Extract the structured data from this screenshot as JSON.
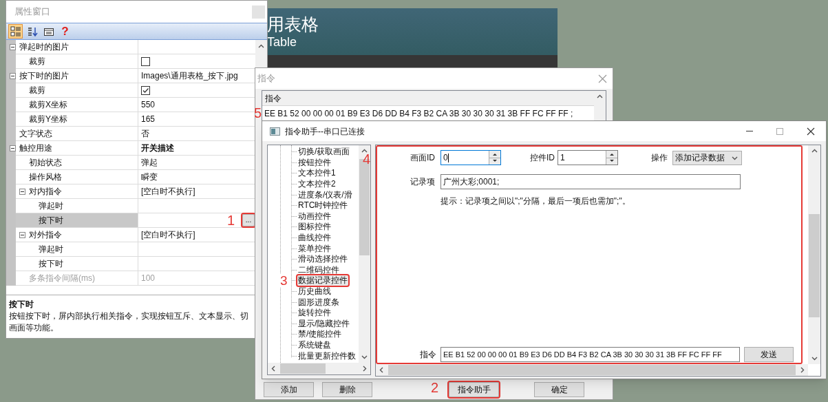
{
  "preview_screen": {
    "title": "用表格",
    "subtitle": "Table"
  },
  "property_window": {
    "title": "属性窗口",
    "toolbar": [
      {
        "kind": "categorized",
        "selected": true
      },
      {
        "kind": "alphabetical",
        "selected": false
      },
      {
        "kind": "property-pages",
        "selected": false
      },
      {
        "kind": "help",
        "selected": false,
        "label": "?"
      }
    ],
    "rows": [
      {
        "name": "弹起时的图片",
        "kind": "group",
        "expanded": true,
        "selected": false,
        "disabled": false,
        "children": [
          {
            "name": "裁剪",
            "kind": "checkbox",
            "checked": false,
            "selected": false,
            "disabled": false
          }
        ]
      },
      {
        "name": "按下时的图片",
        "kind": "group",
        "expanded": true,
        "value": "Images\\通用表格_按下.jpg",
        "selected": false,
        "disabled": false,
        "children": [
          {
            "name": "裁剪",
            "kind": "checkbox",
            "checked": true,
            "selected": false,
            "disabled": false
          },
          {
            "name": "裁剪X坐标",
            "kind": "text",
            "value": "550",
            "selected": false,
            "disabled": false
          },
          {
            "name": "裁剪Y坐标",
            "kind": "text",
            "value": "165",
            "selected": false,
            "disabled": false
          }
        ]
      },
      {
        "name": "文字状态",
        "kind": "text",
        "value": "否",
        "selected": false,
        "disabled": false
      },
      {
        "name": "触控用途",
        "kind": "group",
        "expanded": true,
        "value": "开关描述",
        "value_bold": true,
        "selected": false,
        "disabled": false,
        "children": [
          {
            "name": "初始状态",
            "kind": "text",
            "value": "弹起",
            "selected": false,
            "disabled": false
          },
          {
            "name": "操作风格",
            "kind": "text",
            "value": "瞬变",
            "selected": false,
            "disabled": false
          },
          {
            "name": "对内指令",
            "kind": "group",
            "expanded": true,
            "value": "[空白时不执行]",
            "selected": false,
            "disabled": false,
            "children": [
              {
                "name": "弹起时",
                "kind": "text",
                "selected": false,
                "disabled": false
              },
              {
                "name": "按下时",
                "kind": "text",
                "selected": true,
                "disabled": false,
                "button": "...",
                "annotation": "1"
              }
            ]
          },
          {
            "name": "对外指令",
            "kind": "group",
            "expanded": true,
            "value": "[空白时不执行]",
            "selected": false,
            "disabled": false,
            "children": [
              {
                "name": "弹起时",
                "kind": "text",
                "selected": false,
                "disabled": false
              },
              {
                "name": "按下时",
                "kind": "text",
                "selected": false,
                "disabled": false
              }
            ]
          },
          {
            "name": "多条指令间隔(ms)",
            "kind": "text",
            "value": "100",
            "selected": false,
            "disabled": true
          }
        ]
      }
    ],
    "description": {
      "title": "按下时",
      "lines": [
        "按钮按下时，屏内部执行相关指令，实现按钮互斥、文本显示、切",
        "画面等功能。"
      ]
    }
  },
  "command_window": {
    "title": "指令",
    "list": {
      "header": "指令",
      "rows": [
        {
          "text": "EE B1 52 00 00 00 01 B9 E3 D6 DD B4 F3 B2 CA 3B 30 30 30 31 3B FF FC FF FF ;",
          "annotation": "5"
        }
      ]
    },
    "buttons": [
      {
        "label": "添加"
      },
      {
        "label": "删除"
      },
      {
        "label": "指令助手",
        "annotation": "2"
      },
      {
        "label": "确定"
      }
    ]
  },
  "helper_window": {
    "title": "指令助手--串口已连接",
    "tree": [
      {
        "label": "切换/获取画面",
        "selected": false
      },
      {
        "label": "按钮控件",
        "selected": false
      },
      {
        "label": "文本控件1",
        "selected": false
      },
      {
        "label": "文本控件2",
        "selected": false
      },
      {
        "label": "进度条/仪表/滑",
        "selected": false
      },
      {
        "label": "RTC时钟控件",
        "selected": false
      },
      {
        "label": "动画控件",
        "selected": false
      },
      {
        "label": "图标控件",
        "selected": false
      },
      {
        "label": "曲线控件",
        "selected": false
      },
      {
        "label": "菜单控件",
        "selected": false
      },
      {
        "label": "滑动选择控件",
        "selected": false
      },
      {
        "label": "二维码控件",
        "selected": false
      },
      {
        "label": "数据记录控件",
        "selected": true,
        "annotation": "3"
      },
      {
        "label": "历史曲线",
        "selected": false
      },
      {
        "label": "圆形进度条",
        "selected": false
      },
      {
        "label": "旋转控件",
        "selected": false
      },
      {
        "label": "显示/隐藏控件",
        "selected": false
      },
      {
        "label": "禁/使能控件",
        "selected": false
      },
      {
        "label": "系统键盘",
        "selected": false
      },
      {
        "label": "批量更新控件数",
        "selected": false
      }
    ],
    "form": {
      "annotation": "4",
      "screen_id": {
        "label": "画面ID",
        "value": "0",
        "focused": true
      },
      "control_id": {
        "label": "控件ID",
        "value": "1",
        "focused": false
      },
      "operation": {
        "label": "操作",
        "value": "添加记录数据"
      },
      "record": {
        "label": "记录项",
        "value": "广州大彩;0001;"
      },
      "hint": "提示：记录项之间以\";\"分隔，最后一项后也需加\";\"。",
      "command": {
        "label": "指令",
        "value": "EE B1 52 00 00 00 01 B9 E3 D6 DD B4 F3 B2 CA 3B 30 30 30 31 3B FF FC FF FF"
      },
      "send_button": "发送"
    }
  }
}
